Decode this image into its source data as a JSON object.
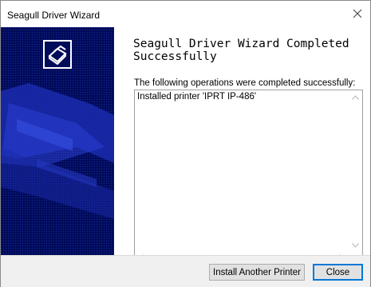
{
  "window": {
    "title": "Seagull Driver Wizard"
  },
  "icons": {
    "close": "close-icon",
    "printer": "printer-icon"
  },
  "content": {
    "heading": "Seagull Driver Wizard Completed Successfully",
    "ops_label": "The following operations were completed successfully:",
    "list_items": [
      "Installed printer 'IPRT IP-486'"
    ]
  },
  "buttons": {
    "install_another": "Install Another Printer",
    "close": "Close"
  },
  "colors": {
    "side_panel": "#000b5a",
    "accent": "#0078d7"
  }
}
